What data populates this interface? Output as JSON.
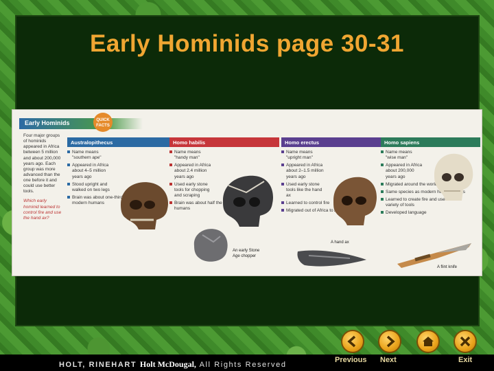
{
  "slide": {
    "title": "Early Hominids page 30-31"
  },
  "textbook": {
    "header": "Early Hominids",
    "badge": "QUICK FACTS",
    "intro": "Four major groups of hominids appeared in Africa between 5 million and about 200,000 years ago. Each group was more advanced than the one before it and could use better tools.",
    "question": "Which early hominid learned to control fire and use the hand ax?",
    "columns": [
      {
        "name": "Australopithecus",
        "facts": [
          "Name means \"southern ape\"",
          "Appeared in Africa about 4–5 million years ago",
          "Stood upright and walked on two legs",
          "Brain was about one-third the size of modern humans"
        ]
      },
      {
        "name": "Homo habilis",
        "facts": [
          "Name means \"handy man\"",
          "Appeared in Africa about 2.4 million years ago",
          "Used early stone tools for chopping and scraping",
          "Brain was about half the size of modern humans"
        ]
      },
      {
        "name": "Homo erectus",
        "facts": [
          "Name means \"upright man\"",
          "Appeared in Africa about 2–1.5 million years ago",
          "Used early stone tools like the hand ax",
          "Learned to control fire",
          "Migrated out of Africa to Asia and Europe"
        ]
      },
      {
        "name": "Homo sapiens",
        "facts": [
          "Name means \"wise man\"",
          "Appeared in Africa about 200,000 years ago",
          "Migrated around the world",
          "Same species as modern human beings",
          "Learned to create fire and use a wide variety of tools",
          "Developed language"
        ]
      }
    ],
    "tool_captions": {
      "chopper": "An early Stone Age chopper",
      "hand_ax": "A hand ax",
      "knife": "A flint knife"
    }
  },
  "footer": {
    "publisher_left": "HOLT, RINEHART",
    "publisher_mid": "Holt McDougal,",
    "publisher_right": "All Rights Reserved"
  },
  "nav": {
    "previous": "Previous",
    "next": "Next",
    "exit": "Exit"
  },
  "colors": {
    "title": "#f0a632",
    "board": "#0c2a08",
    "button": "#e9a21a"
  }
}
